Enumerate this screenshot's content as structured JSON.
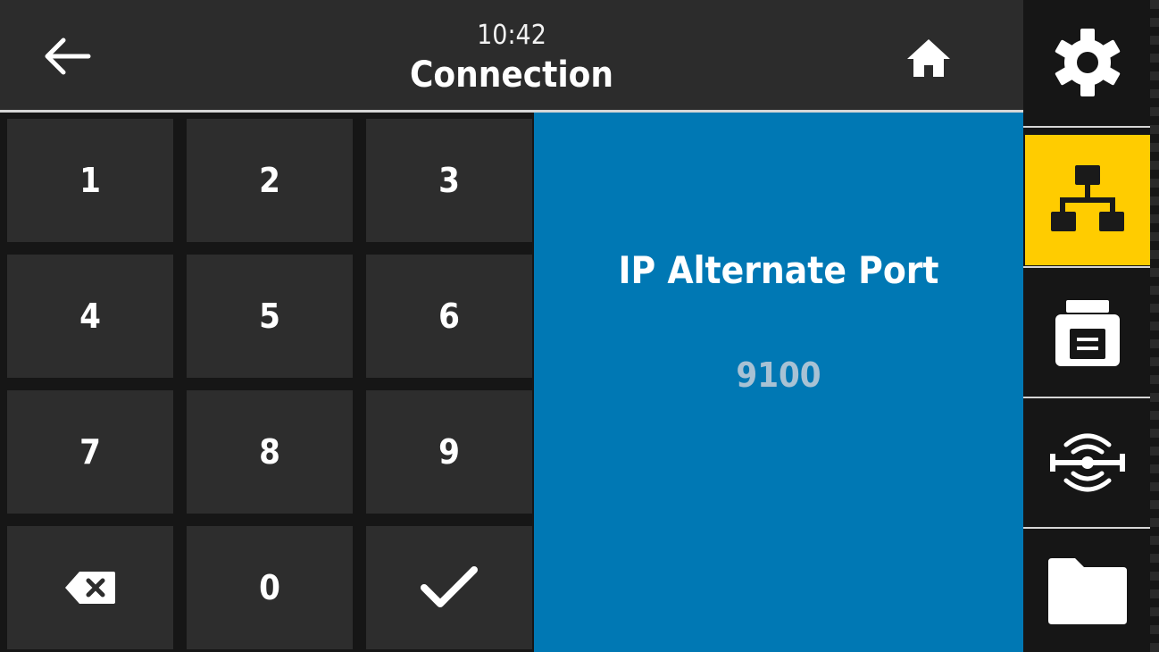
{
  "header": {
    "time": "10:42",
    "title": "Connection"
  },
  "keypad": {
    "keys": [
      "1",
      "2",
      "3",
      "4",
      "5",
      "6",
      "7",
      "8",
      "9",
      "0"
    ]
  },
  "setting": {
    "label": "IP Alternate Port",
    "value": "9100"
  },
  "sidebar": {
    "items": [
      {
        "icon": "gear-icon",
        "active": false
      },
      {
        "icon": "network-icon",
        "active": true
      },
      {
        "icon": "printer-icon",
        "active": false
      },
      {
        "icon": "sensor-icon",
        "active": false
      },
      {
        "icon": "folder-icon",
        "active": false
      }
    ]
  },
  "colors": {
    "header_bg": "#2c2c2c",
    "key_bg": "#2d2d2d",
    "panel_blue": "#0078b4",
    "active_tab": "#ffcc00",
    "value_text": "#a8c2d4"
  }
}
